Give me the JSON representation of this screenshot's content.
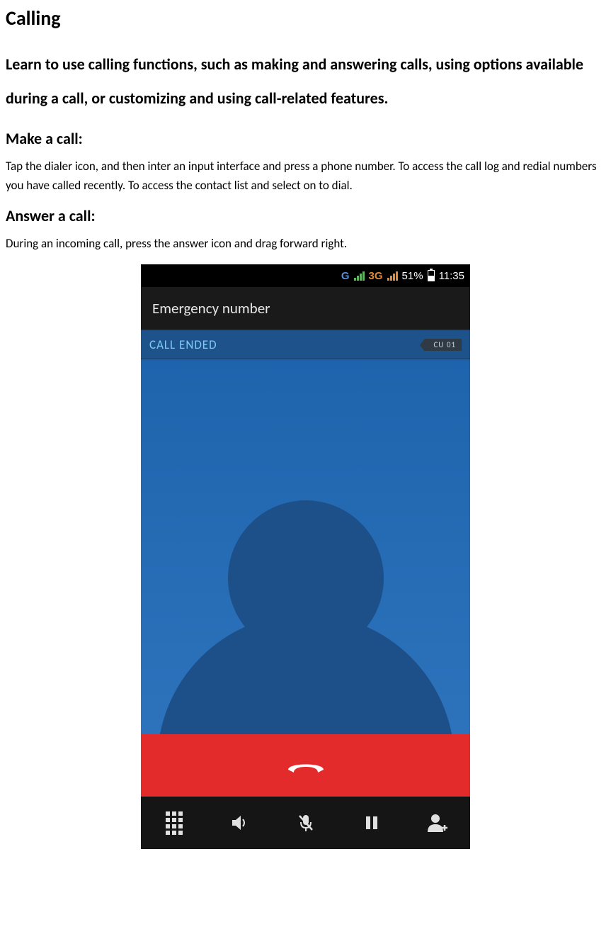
{
  "doc": {
    "title": "Calling",
    "intro": "Learn to use calling functions, such as making and answering calls, using options available during a call, or customizing and using call-related features.",
    "make_heading": "Make a call:",
    "make_body": "Tap the dialer icon, and then inter an input interface and press a phone number. To access the call log and redial numbers you have called recently. To access the contact list and select on to dial.",
    "answer_heading": "Answer a call:",
    "answer_body": "During an incoming call, press the answer icon and drag forward right."
  },
  "phone": {
    "status": {
      "g": "G",
      "threeg": "3G",
      "battery_pct": "51%",
      "time": "11:35"
    },
    "caller": "Emergency number",
    "call_status": "CALL ENDED",
    "sim_label": "CU 01",
    "toolbar": {
      "dialpad": "dialpad",
      "speaker": "speaker",
      "mute": "mute",
      "hold": "hold",
      "add_contact": "add-contact"
    }
  }
}
